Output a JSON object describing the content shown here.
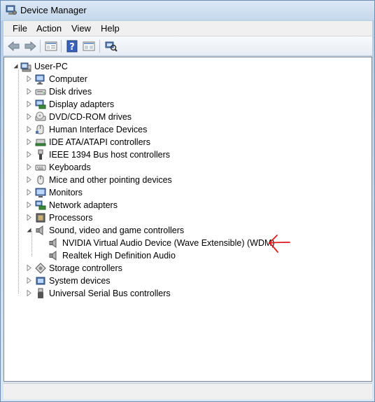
{
  "window": {
    "title": "Device Manager"
  },
  "menu": {
    "file": "File",
    "action": "Action",
    "view": "View",
    "help": "Help"
  },
  "toolbar": [
    "back-icon",
    "forward-icon",
    "properties-icon",
    "help-icon",
    "show-hidden-icon",
    "scan-hardware-icon"
  ],
  "tree": {
    "root": "User-PC",
    "items": [
      {
        "label": "Computer",
        "icon": "computer-icon"
      },
      {
        "label": "Disk drives",
        "icon": "disk-drive-icon"
      },
      {
        "label": "Display adapters",
        "icon": "display-adapter-icon"
      },
      {
        "label": "DVD/CD-ROM drives",
        "icon": "dvd-drive-icon"
      },
      {
        "label": "Human Interface Devices",
        "icon": "hid-icon"
      },
      {
        "label": "IDE ATA/ATAPI controllers",
        "icon": "ide-controller-icon"
      },
      {
        "label": "IEEE 1394 Bus host controllers",
        "icon": "firewire-icon"
      },
      {
        "label": "Keyboards",
        "icon": "keyboard-icon"
      },
      {
        "label": "Mice and other pointing devices",
        "icon": "mouse-icon"
      },
      {
        "label": "Monitors",
        "icon": "monitor-icon"
      },
      {
        "label": "Network adapters",
        "icon": "network-adapter-icon"
      },
      {
        "label": "Processors",
        "icon": "processor-icon"
      },
      {
        "label": "Sound, video and game controllers",
        "icon": "speaker-icon",
        "expanded": true,
        "children": [
          {
            "label": "NVIDIA Virtual Audio Device (Wave Extensible) (WDM)",
            "icon": "speaker-icon"
          },
          {
            "label": "Realtek High Definition Audio",
            "icon": "speaker-icon"
          }
        ]
      },
      {
        "label": "Storage controllers",
        "icon": "storage-controller-icon"
      },
      {
        "label": "System devices",
        "icon": "system-device-icon"
      },
      {
        "label": "Universal Serial Bus controllers",
        "icon": "usb-icon"
      }
    ]
  },
  "annotation": {
    "icon": "red-arrow-icon",
    "color": "#e01818"
  }
}
